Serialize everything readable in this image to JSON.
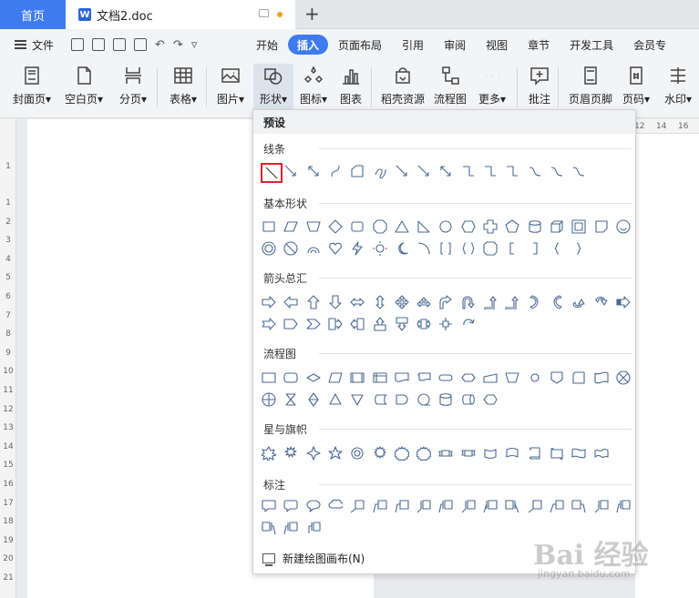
{
  "tabs": {
    "home": "首页",
    "doc": "文档2.doc",
    "logo": "W",
    "add": "+"
  },
  "menu": {
    "file": "文件",
    "quick_undo": "↶",
    "quick_redo": "↷",
    "quick_more": "▿",
    "tabs": [
      "开始",
      "插入",
      "页面布局",
      "引用",
      "审阅",
      "视图",
      "章节",
      "开发工具",
      "会员专"
    ],
    "active_tab": "插入"
  },
  "ribbon": {
    "buttons": [
      {
        "label": "封面页",
        "dropdown": true,
        "icon": "cover-page-icon"
      },
      {
        "label": "空白页",
        "dropdown": true,
        "icon": "blank-page-icon"
      },
      {
        "label": "分页",
        "dropdown": true,
        "icon": "page-break-icon"
      },
      {
        "label": "表格",
        "dropdown": true,
        "icon": "table-icon"
      },
      {
        "label": "图片",
        "dropdown": true,
        "icon": "picture-icon"
      },
      {
        "label": "形状",
        "dropdown": true,
        "icon": "shape-icon"
      },
      {
        "label": "图标",
        "dropdown": true,
        "icon": "icons-icon"
      },
      {
        "label": "图表",
        "dropdown": false,
        "icon": "chart-icon"
      },
      {
        "label": "稻壳资源",
        "dropdown": false,
        "icon": "docer-resource-icon"
      },
      {
        "label": "流程图",
        "dropdown": false,
        "icon": "flowchart-icon"
      },
      {
        "label": "更多",
        "dropdown": true,
        "icon": "more-icon"
      },
      {
        "label": "批注",
        "dropdown": false,
        "icon": "comment-icon"
      },
      {
        "label": "页眉页脚",
        "dropdown": false,
        "icon": "header-footer-icon"
      },
      {
        "label": "页码",
        "dropdown": true,
        "icon": "page-number-icon"
      },
      {
        "label": "水印",
        "dropdown": true,
        "icon": "watermark-icon"
      }
    ],
    "dropdown_arrow": "▾"
  },
  "ruler": {
    "left_marks": [
      "1",
      "1",
      "2",
      "3",
      "4",
      "5",
      "6",
      "7",
      "8",
      "9",
      "10",
      "11",
      "12",
      "13",
      "14",
      "15",
      "16",
      "17",
      "18",
      "19",
      "20",
      "21"
    ],
    "top_marks": [
      "12",
      "14",
      "16"
    ]
  },
  "panel": {
    "header": "预设",
    "sections": [
      {
        "title": "线条"
      },
      {
        "title": "基本形状"
      },
      {
        "title": "箭头总汇"
      },
      {
        "title": "流程图"
      },
      {
        "title": "星与旗帜"
      },
      {
        "title": "标注"
      }
    ],
    "new_canvas": "新建绘图画布(N)"
  },
  "watermark": {
    "main": "Bai 经验",
    "sub": "jingyan.baidu.com"
  },
  "colors": {
    "accent": "#3f7bf0",
    "selected_border": "#d9232d",
    "shape_stroke": "#4a6a92"
  }
}
